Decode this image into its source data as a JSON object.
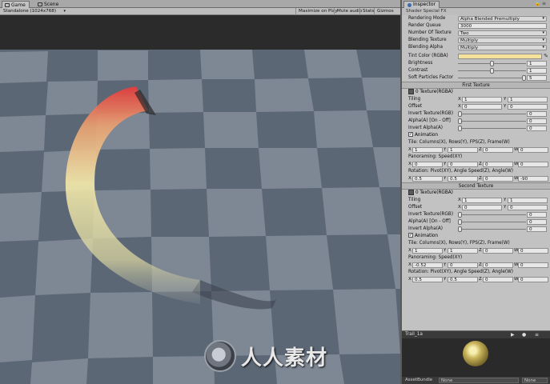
{
  "game": {
    "tab_game": "Game",
    "tab_scene": "Scene",
    "resolution": "Standalone (1024x768)",
    "btn_maximize": "Maximize on Play",
    "btn_mute": "Mute audio",
    "btn_stats": "Stats",
    "btn_gizmos": "Gizmos",
    "watermark": "人人素材"
  },
  "inspector": {
    "tab_title": "Inspector",
    "shader_label": "Shader",
    "shader_value": "Special FX",
    "rendering_mode_label": "Rendering Mode",
    "rendering_mode_value": "Alpha Blended Premultiply",
    "render_queue_label": "Render Queue",
    "render_queue_value": "3000",
    "num_texture_label": "Number Of Texture",
    "num_texture_value": "Two",
    "blending_texture_label": "Blending Texture",
    "blending_texture_value": "Multiply",
    "blending_alpha_label": "Blending Alpha",
    "blending_alpha_value": "Multiply",
    "tint_label": "Tint Color (RGBA)",
    "tint_color": "#f4e29b",
    "brightness_label": "Brightness",
    "brightness_value": "1",
    "brightness_fraction": 0.5,
    "contrast_label": "Contrast",
    "contrast_value": "1",
    "contrast_fraction": 0.5,
    "soft_label": "Soft Particles Factor",
    "soft_value": "5",
    "soft_fraction": 0.98,
    "first": {
      "section": "First Texture",
      "texture": "0 Texture(RGBA)",
      "tiling": "Tiling",
      "tiling_x": "1",
      "tiling_y": "1",
      "offset": "Offset",
      "offset_x": "0",
      "offset_y": "0",
      "invert_rgb": "Invert Texture(RGB)",
      "invert_rgb_value": "0",
      "alpha_onoff": "Alpha(A) [On - Off]",
      "alpha_onoff_value": "0",
      "invert_alpha": "Invert Alpha(A)",
      "invert_alpha_value": "0",
      "animation": "Animation",
      "tile_label": "Tile: Columns(X), Rows(Y), FPS(Z), Frame(W)",
      "tile": [
        "1",
        "1",
        "0",
        "0"
      ],
      "pan_label": "Panoraming: Speed(XY)",
      "pan": [
        "0",
        "0",
        "0",
        "0"
      ],
      "rot_label": "Rotation: Pivot(XY), Angle Speed(Z), Angle(W)",
      "rot": [
        "0.5",
        "0.5",
        "0",
        "-90"
      ]
    },
    "second": {
      "section": "Second Texture",
      "texture": "0 Texture(RGBA)",
      "tiling": "Tiling",
      "tiling_x": "1",
      "tiling_y": "1",
      "offset": "Offset",
      "offset_x": "0",
      "offset_y": "0",
      "invert_rgb": "Invert Texture(RGB)",
      "invert_rgb_value": "0",
      "alpha_onoff": "Alpha(A) [On - Off]",
      "alpha_onoff_value": "0",
      "invert_alpha": "Invert Alpha(A)",
      "invert_alpha_value": "0",
      "animation": "Animation",
      "tile_label": "Tile: Columns(X), Rows(Y), FPS(Z), Frame(W)",
      "tile": [
        "1",
        "1",
        "0",
        "0"
      ],
      "pan_label": "Panoraming: Speed(XY)",
      "pan": [
        "-0.52",
        "0",
        "0",
        "0"
      ],
      "rot_label": "Rotation: Pivot(XY), Angle Speed(Z), Angle(W)",
      "rot": [
        "0.5",
        "0.5",
        "0",
        "0"
      ]
    },
    "preview_name": "Trail_1a",
    "assetbundle_label": "AssetBundle",
    "assetbundle_value": "None",
    "assetbundle_variant": "None"
  }
}
